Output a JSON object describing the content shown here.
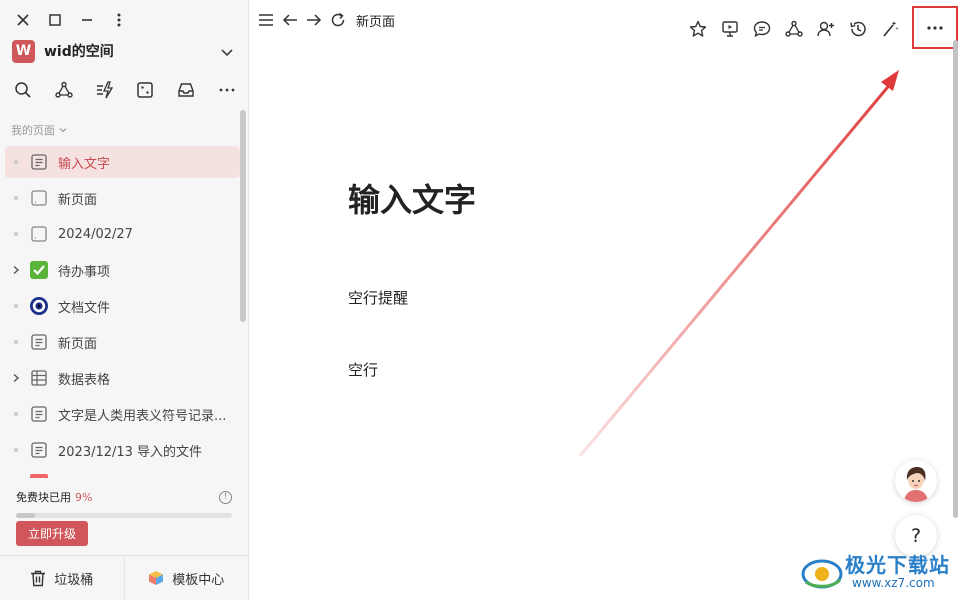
{
  "workspace": {
    "avatar_letter": "W",
    "name": "wid的空间"
  },
  "sidebar": {
    "section_label": "我的页面",
    "pages": [
      {
        "label": "输入文字",
        "icon": "doc-icon",
        "active": true
      },
      {
        "label": "新页面",
        "icon": "blank-page-icon"
      },
      {
        "label": "2024/02/27",
        "icon": "blank-page-icon"
      },
      {
        "label": "待办事项",
        "icon": "green-checkbox-icon",
        "expandable": true
      },
      {
        "label": "文档文件",
        "icon": "eye-circle-icon"
      },
      {
        "label": "新页面",
        "icon": "doc-icon"
      },
      {
        "label": "数据表格",
        "icon": "table-icon",
        "expandable": true
      },
      {
        "label": "文字是人类用表义符号记录...",
        "icon": "doc-icon"
      },
      {
        "label": "2023/12/13 导入的文件",
        "icon": "doc-icon"
      }
    ],
    "usage": {
      "label": "免费块已用",
      "percent_text": "9%",
      "percent": 0.09
    },
    "upgrade_label": "立即升级",
    "trash_label": "垃圾桶",
    "templates_label": "模板中心"
  },
  "topbar": {
    "page_title": "新页面"
  },
  "document": {
    "title": "输入文字",
    "lines": [
      "空行提醒",
      "空行"
    ]
  },
  "watermark": {
    "brand": "极光下载站",
    "url": "www.xz7.com"
  },
  "colors": {
    "accent": "#d0565b",
    "highlight_box": "#e03a3a",
    "active_bg": "#f6e1e1"
  }
}
